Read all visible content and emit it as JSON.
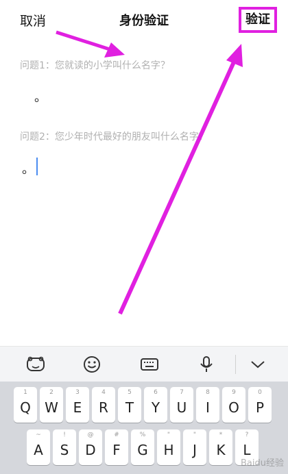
{
  "header": {
    "cancel_label": "取消",
    "title": "身份验证",
    "verify_label": "验证"
  },
  "questions": [
    {
      "label": "问题1：您就读的小学叫什么名字？",
      "answer": "。"
    },
    {
      "label": "问题2：您少年时代最好的朋友叫什么名字？",
      "answer": "。"
    }
  ],
  "toolbar": {
    "icons": [
      "du-logo-icon",
      "emoji-icon",
      "keyboard-icon",
      "microphone-icon",
      "chevron-down-icon"
    ]
  },
  "keyboard": {
    "row1": [
      {
        "main": "Q",
        "sub": "1"
      },
      {
        "main": "W",
        "sub": "2"
      },
      {
        "main": "E",
        "sub": "3"
      },
      {
        "main": "R",
        "sub": "4"
      },
      {
        "main": "T",
        "sub": "5"
      },
      {
        "main": "Y",
        "sub": "6"
      },
      {
        "main": "U",
        "sub": "7"
      },
      {
        "main": "I",
        "sub": "8"
      },
      {
        "main": "O",
        "sub": "9"
      },
      {
        "main": "P",
        "sub": "0"
      }
    ],
    "row2": [
      {
        "main": "A",
        "sub": "~"
      },
      {
        "main": "S",
        "sub": "!"
      },
      {
        "main": "D",
        "sub": "@"
      },
      {
        "main": "F",
        "sub": "#"
      },
      {
        "main": "G",
        "sub": "%"
      },
      {
        "main": "H",
        "sub": "\""
      },
      {
        "main": "J",
        "sub": "\""
      },
      {
        "main": "K",
        "sub": "*"
      },
      {
        "main": "L",
        "sub": "?"
      }
    ]
  },
  "watermark": "Baidu经验",
  "colors": {
    "annotation": "#e020e0",
    "caret": "#4a8cf0"
  }
}
